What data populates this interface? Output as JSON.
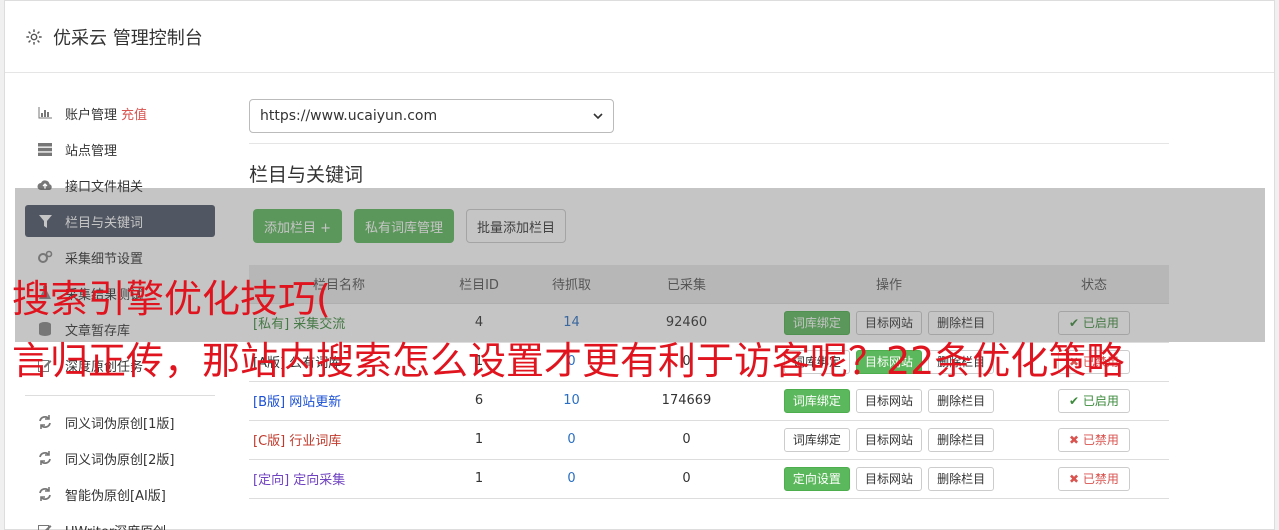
{
  "header": {
    "title": "优采云 管理控制台",
    "icon": "gear-icon"
  },
  "sidebar": {
    "items": [
      {
        "label": "账户管理",
        "extra": "充值",
        "icon": "bar-chart-icon"
      },
      {
        "label": "站点管理",
        "icon": "server-icon"
      },
      {
        "label": "接口文件相关",
        "icon": "cloud-upload-icon"
      },
      {
        "label": "栏目与关键词",
        "icon": "filter-icon",
        "active": true
      },
      {
        "label": "采集细节设置",
        "icon": "cogs-icon"
      },
      {
        "label": "采集结果测试",
        "icon": "flask-icon"
      },
      {
        "label": "文章暂存库",
        "icon": "database-icon"
      },
      {
        "label": "深度原创任务",
        "icon": "edit-icon"
      }
    ],
    "tools": [
      {
        "label": "同义词伪原创[1版]",
        "icon": "refresh-icon"
      },
      {
        "label": "同义词伪原创[2版]",
        "icon": "refresh-icon"
      },
      {
        "label": "智能伪原创[AI版]",
        "icon": "refresh-icon"
      },
      {
        "label": "UWriter深度原创",
        "icon": "edit-icon"
      }
    ]
  },
  "main": {
    "site_select": {
      "value": "https://www.ucaiyun.com"
    },
    "section_title": "栏目与关键词",
    "buttons": {
      "add_column": "添加栏目 +",
      "private_lib": "私有词库管理",
      "batch_add": "批量添加栏目"
    },
    "table": {
      "headers": [
        "栏目名称",
        "栏目ID",
        "待抓取",
        "已采集",
        "操作",
        "状态"
      ],
      "rows": [
        {
          "tag": "[私有]",
          "name": "采集交流",
          "id": "4",
          "pending": "14",
          "collected": "92460",
          "op1": "词库绑定",
          "op2": "目标网站",
          "op3": "删除栏目",
          "status": "已启用"
        },
        {
          "tag": "[A版]",
          "name": "公有词库",
          "id": "1",
          "pending": "0",
          "collected": "0",
          "op1": "词库绑定",
          "op2": "目标网站",
          "op3": "删除栏目",
          "status": "已禁用"
        },
        {
          "tag": "[B版]",
          "name": "网站更新",
          "id": "6",
          "pending": "10",
          "collected": "174669",
          "op1": "词库绑定",
          "op2": "目标网站",
          "op3": "删除栏目",
          "status": "已启用"
        },
        {
          "tag": "[C版]",
          "name": "行业词库",
          "id": "1",
          "pending": "0",
          "collected": "0",
          "op1": "词库绑定",
          "op2": "目标网站",
          "op3": "删除栏目",
          "status": "已禁用"
        },
        {
          "tag": "[定向]",
          "name": "定向采集",
          "id": "1",
          "pending": "0",
          "collected": "0",
          "op1": "定向设置",
          "op2": "目标网站",
          "op3": "删除栏目",
          "status": "已禁用"
        }
      ]
    }
  },
  "banner": {
    "line1": "搜索引擎优化技巧(",
    "line2": "言归正传，那站内搜索怎么设置才更有利于访客呢？22条优化策略"
  },
  "colors": {
    "active_sidebar": "#4d5668",
    "green": "#5cb85c",
    "banner_red": "#e0141e"
  }
}
